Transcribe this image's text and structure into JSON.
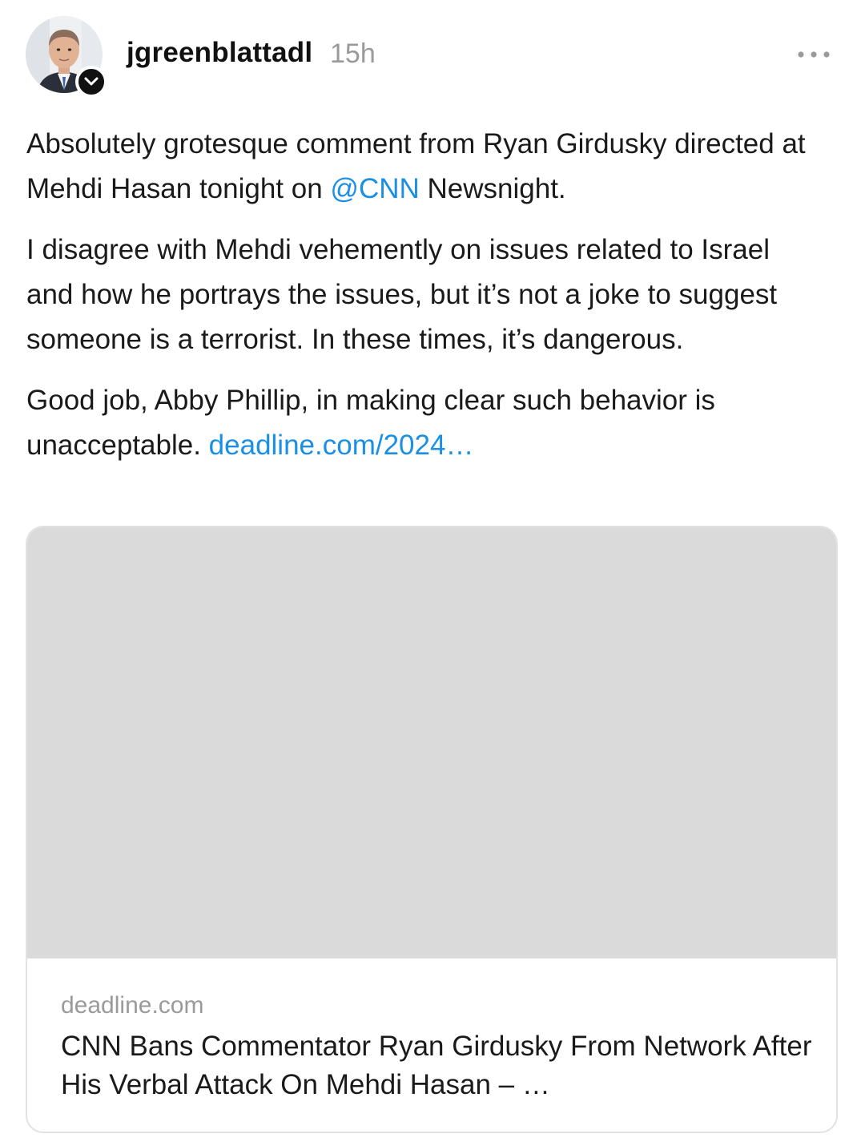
{
  "post": {
    "author": {
      "username": "jgreenblattadl",
      "avatar_icon": "profile-photo",
      "follow_badge_icon": "chevron-down-icon"
    },
    "timestamp": "15h",
    "more_icon": "more-horizontal-icon",
    "body": {
      "p1_before": "Absolutely grotesque comment from Ryan Girdusky directed at Mehdi Hasan tonight on ",
      "p1_mention": "@CNN",
      "p1_after": " Newsnight.",
      "p2": "I disagree with Mehdi vehemently on issues related to Israel and how he portrays the issues, but it’s not a joke to suggest someone is a terrorist. In these times, it’s dangerous.",
      "p3_before": "Good job, Abby Phillip, in making clear such behavior is unacceptable. ",
      "p3_link": "deadline.com/2024…"
    },
    "link_card": {
      "domain": "deadline.com",
      "title": "CNN Bans Commentator Ryan Girdusky From Network After His Verbal Attack On Mehdi Hasan – …"
    }
  },
  "colors": {
    "link": "#1a8fe3",
    "text": "#1a1a1a",
    "muted": "#9a9a9a",
    "card_image_placeholder": "#dadada",
    "card_border": "#e2e2e2"
  }
}
